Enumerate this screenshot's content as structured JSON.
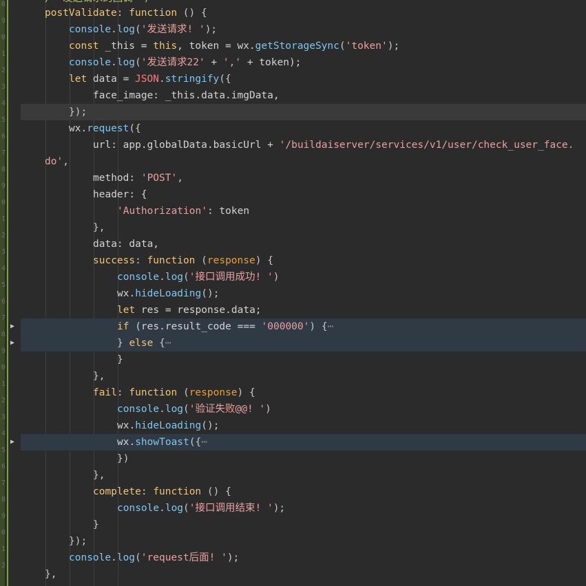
{
  "code": {
    "header_partial": "/* 发送请求的回调 */",
    "lines": [
      {
        "tokens": [
          [
            "kw",
            "postValidate"
          ],
          [
            "punc",
            ": "
          ],
          [
            "kw",
            "function"
          ],
          [
            "punc",
            " () {"
          ]
        ]
      },
      {
        "tokens": [
          [
            "fn",
            "console"
          ],
          [
            "punc",
            "."
          ],
          [
            "fn",
            "log"
          ],
          [
            "punc",
            "("
          ],
          [
            "str",
            "'发送请求! '"
          ],
          [
            "punc",
            ");"
          ]
        ]
      },
      {
        "tokens": [
          [
            "kw",
            "const"
          ],
          [
            "id",
            " _this = "
          ],
          [
            "kw",
            "this"
          ],
          [
            "id",
            ", token = wx."
          ],
          [
            "fn",
            "getStorageSync"
          ],
          [
            "punc",
            "("
          ],
          [
            "str",
            "'token'"
          ],
          [
            "punc",
            ");"
          ]
        ]
      },
      {
        "tokens": [
          [
            "fn",
            "console"
          ],
          [
            "punc",
            "."
          ],
          [
            "fn",
            "log"
          ],
          [
            "punc",
            "("
          ],
          [
            "str",
            "'发送请求22'"
          ],
          [
            "id",
            " + "
          ],
          [
            "str",
            "','"
          ],
          [
            "id",
            " + token);"
          ]
        ]
      },
      {
        "tokens": [
          [
            "kw",
            "let"
          ],
          [
            "id",
            " data = "
          ],
          [
            "pink",
            "JSON"
          ],
          [
            "punc",
            "."
          ],
          [
            "fn",
            "stringify"
          ],
          [
            "punc",
            "({"
          ]
        ]
      },
      {
        "tokens": [
          [
            "id",
            "face_image: _this.data.imgData,"
          ]
        ]
      },
      {
        "tokens": [
          [
            "punc",
            "});"
          ]
        ]
      },
      {
        "tokens": [
          [
            "id",
            "wx."
          ],
          [
            "fn",
            "request"
          ],
          [
            "punc",
            "({"
          ]
        ]
      },
      {
        "tokens": [
          [
            "id",
            "url: app.globalData.basicUrl + "
          ],
          [
            "str",
            "'/buildaiserver/services/v1/user/check_user_face."
          ]
        ]
      },
      {
        "tokens": [
          [
            "str",
            "do'"
          ],
          [
            "punc",
            ","
          ]
        ]
      },
      {
        "tokens": [
          [
            "id",
            "method: "
          ],
          [
            "str",
            "'POST'"
          ],
          [
            "punc",
            ","
          ]
        ]
      },
      {
        "tokens": [
          [
            "id",
            "header: {"
          ]
        ]
      },
      {
        "tokens": [
          [
            "str",
            "'Authorization'"
          ],
          [
            "id",
            ": token"
          ]
        ]
      },
      {
        "tokens": [
          [
            "punc",
            "},"
          ]
        ]
      },
      {
        "tokens": [
          [
            "id",
            "data: data,"
          ]
        ]
      },
      {
        "tokens": [
          [
            "kw",
            "success"
          ],
          [
            "punc",
            ": "
          ],
          [
            "kw",
            "function"
          ],
          [
            "punc",
            " ("
          ],
          [
            "orange",
            "response"
          ],
          [
            "punc",
            ") {"
          ]
        ]
      },
      {
        "tokens": [
          [
            "fn",
            "console"
          ],
          [
            "punc",
            "."
          ],
          [
            "fn",
            "log"
          ],
          [
            "punc",
            "("
          ],
          [
            "str",
            "'接口调用成功! '"
          ],
          [
            "punc",
            ")"
          ]
        ]
      },
      {
        "tokens": [
          [
            "id",
            "wx."
          ],
          [
            "fn",
            "hideLoading"
          ],
          [
            "punc",
            "();"
          ]
        ]
      },
      {
        "tokens": [
          [
            "kw",
            "let"
          ],
          [
            "id",
            " res = response.data;"
          ]
        ]
      },
      {
        "tokens": [
          [
            "kw",
            "if"
          ],
          [
            "id",
            " (res.result_code === "
          ],
          [
            "str",
            "'000000'"
          ],
          [
            "punc",
            ") {"
          ],
          [
            "fold-ellipsis",
            "⋯"
          ]
        ]
      },
      {
        "tokens": [
          [
            "punc",
            "} "
          ],
          [
            "kw",
            "else"
          ],
          [
            "punc",
            " {"
          ],
          [
            "fold-ellipsis",
            "⋯"
          ]
        ]
      },
      {
        "tokens": [
          [
            "punc",
            "}"
          ]
        ]
      },
      {
        "tokens": [
          [
            "punc",
            "},"
          ]
        ]
      },
      {
        "tokens": [
          [
            "kw",
            "fail"
          ],
          [
            "punc",
            ": "
          ],
          [
            "kw",
            "function"
          ],
          [
            "punc",
            " ("
          ],
          [
            "orange",
            "response"
          ],
          [
            "punc",
            ") {"
          ]
        ]
      },
      {
        "tokens": [
          [
            "fn",
            "console"
          ],
          [
            "punc",
            "."
          ],
          [
            "fn",
            "log"
          ],
          [
            "punc",
            "("
          ],
          [
            "str",
            "'验证失败@@! '"
          ],
          [
            "punc",
            ")"
          ]
        ]
      },
      {
        "tokens": [
          [
            "id",
            "wx."
          ],
          [
            "fn",
            "hideLoading"
          ],
          [
            "punc",
            "();"
          ]
        ]
      },
      {
        "tokens": [
          [
            "id",
            "wx."
          ],
          [
            "fn",
            "showToast"
          ],
          [
            "punc",
            "({"
          ],
          [
            "fold-ellipsis",
            "⋯"
          ]
        ]
      },
      {
        "tokens": [
          [
            "punc",
            "})"
          ]
        ]
      },
      {
        "tokens": [
          [
            "punc",
            "},"
          ]
        ]
      },
      {
        "tokens": [
          [
            "kw",
            "complete"
          ],
          [
            "punc",
            ": "
          ],
          [
            "kw",
            "function"
          ],
          [
            "punc",
            " () {"
          ]
        ]
      },
      {
        "tokens": [
          [
            "fn",
            "console"
          ],
          [
            "punc",
            "."
          ],
          [
            "fn",
            "log"
          ],
          [
            "punc",
            "("
          ],
          [
            "str",
            "'接口调用结束! '"
          ],
          [
            "punc",
            ");"
          ]
        ]
      },
      {
        "tokens": [
          [
            "punc",
            "}"
          ]
        ]
      },
      {
        "tokens": [
          [
            "punc",
            "});"
          ]
        ]
      },
      {
        "tokens": [
          [
            "fn",
            "console"
          ],
          [
            "punc",
            "."
          ],
          [
            "fn",
            "log"
          ],
          [
            "punc",
            "("
          ],
          [
            "str",
            "'request后面! '"
          ],
          [
            "punc",
            ");"
          ]
        ]
      },
      {
        "tokens": [
          [
            "punc",
            "},"
          ]
        ]
      }
    ]
  },
  "gutter_numbers": [
    "8",
    "9",
    "0",
    "1",
    "2",
    "3",
    "4",
    "5",
    "6",
    "7",
    "8",
    "9",
    "0",
    "1",
    "2",
    "3",
    "4",
    "5",
    "6",
    "7",
    "8",
    "9",
    "0",
    "1",
    "2",
    "3",
    "4",
    "5",
    "6",
    "7",
    "8",
    "9",
    "0",
    "1",
    "2"
  ],
  "fold_icon": "chevron-right-icon",
  "colors": {
    "background": "#2b2b2b",
    "keyword": "#f0c674",
    "function": "#7dc8f0",
    "string": "#e8a0a0",
    "line_highlight": "#3a3a3a",
    "fold_highlight": "#2f3a45"
  }
}
